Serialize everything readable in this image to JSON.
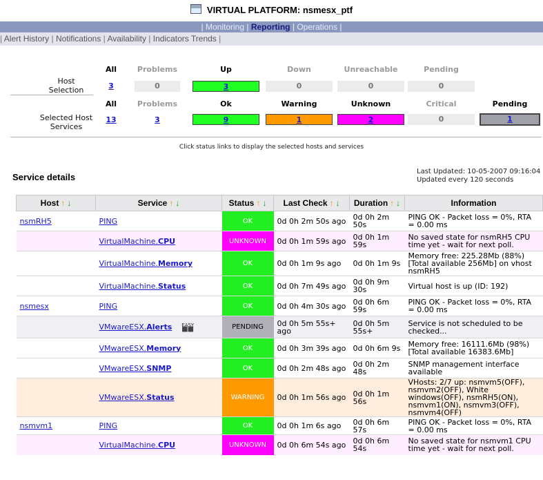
{
  "title": "VIRTUAL PLATFORM: nsmesx_ptf",
  "title_icon": "window-icon",
  "topnav": {
    "monitoring": "Monitoring",
    "reporting": "Reporting",
    "operations": "Operations",
    "sep": "|"
  },
  "subnav": {
    "lead_sep": "|",
    "alert_history": "Alert History",
    "notifications": "Notifications",
    "availability": "Availability",
    "indicators": "Indicators Trends",
    "sep": "|"
  },
  "summary": {
    "host_label": [
      "Host",
      "Selection"
    ],
    "services_label": [
      "Selected Host",
      "Services"
    ],
    "host_headers": {
      "all": "All",
      "problems": "Problems",
      "up": "Up",
      "down": "Down",
      "unreachable": "Unreachable",
      "pending": "Pending"
    },
    "host_values": {
      "all": "3",
      "problems": "0",
      "up": "3",
      "down": "0",
      "unreachable": "0",
      "pending": "0"
    },
    "svc_headers": {
      "all": "All",
      "problems": "Problems",
      "ok": "Ok",
      "warning": "Warning",
      "unknown": "Unknown",
      "critical": "Critical",
      "pending": "Pending"
    },
    "svc_values": {
      "all": "13",
      "problems": "3",
      "ok": "9",
      "warning": "1",
      "unknown": "2",
      "critical": "0",
      "pending": "1"
    },
    "hint": "Click status links to display the selected hosts and services"
  },
  "details": {
    "title": "Service details",
    "last_updated": "Last Updated: 10-05-2007 09:16:04",
    "refresh": "Updated every 120 seconds",
    "columns": {
      "host": "Host",
      "service": "Service",
      "status": "Status",
      "last_check": "Last Check",
      "duration": "Duration",
      "information": "Information"
    },
    "sort_up": "↑",
    "sort_down": "↓",
    "rows": [
      {
        "host": "nsmRH5",
        "svc_prefix": "PING",
        "svc_suffix": "",
        "status": "OK",
        "kind": "ok",
        "last_check": "0d 0h 2m 50s ago",
        "duration": "0d 0h 2m 50s",
        "info": "PING OK - Packet loss = 0%, RTA = 0.00 ms"
      },
      {
        "host": "",
        "svc_prefix": "VirtualMachine.",
        "svc_suffix": "CPU",
        "status": "UNKNOWN",
        "kind": "unk",
        "last_check": "0d 0h 1m 59s ago",
        "duration": "0d 0h 1m 59s",
        "info": "No saved state for nsmRH5 CPU time yet - wait for next poll."
      },
      {
        "host": "",
        "svc_prefix": "VirtualMachine.",
        "svc_suffix": "Memory",
        "status": "OK",
        "kind": "ok",
        "last_check": "0d 0h 1m 9s ago",
        "duration": "0d 0h 1m 9s",
        "info": "Memory free: 225.28Mb (88%) [Total available 256Mb] on vhost nsmRH5"
      },
      {
        "host": "",
        "svc_prefix": "VirtualMachine.",
        "svc_suffix": "Status",
        "status": "OK",
        "kind": "ok",
        "last_check": "0d 0h 7m 49s ago",
        "duration": "0d 0h 9m 30s",
        "info": "Virtual host is up (ID: 192)"
      },
      {
        "host": "nsmesx",
        "svc_prefix": "PING",
        "svc_suffix": "",
        "status": "OK",
        "kind": "ok",
        "last_check": "0d 0h 4m 30s ago",
        "duration": "0d 0h 6m 59s",
        "info": "PING OK - Packet loss = 0%, RTA = 0.00 ms"
      },
      {
        "host": "",
        "svc_prefix": "VMwareESX.",
        "svc_suffix": "Alerts",
        "status": "PENDING",
        "kind": "pending",
        "easy": [
          "EASY",
          "⬛⬛"
        ],
        "last_check": "0d 0h 5m 55s+ ago",
        "duration": "0d 0h 5m 55s+",
        "info": "Service is not scheduled to be checked..."
      },
      {
        "host": "",
        "svc_prefix": "VMwareESX.",
        "svc_suffix": "Memory",
        "status": "OK",
        "kind": "ok",
        "last_check": "0d 0h 3m 39s ago",
        "duration": "0d 0h 6m 9s",
        "info": "Memory free: 16111.6Mb (98%) [Total available 16383.6Mb]"
      },
      {
        "host": "",
        "svc_prefix": "VMwareESX.",
        "svc_suffix": "SNMP",
        "status": "OK",
        "kind": "ok",
        "last_check": "0d 0h 2m 48s ago",
        "duration": "0d 0h 2m 48s",
        "info": "SNMP management interface available"
      },
      {
        "host": "",
        "svc_prefix": "VMwareESX.",
        "svc_suffix": "Status",
        "status": "WARNING",
        "kind": "warn",
        "last_check": "0d 0h 1m 56s ago",
        "duration": "0d 0h 1m 56s",
        "info": "VHosts: 2/7 up: nsmvm5(OFF), nsmvm2(OFF), White windows(OFF), nsmRH5(ON), nsmvm1(ON), nsmvm3(OFF), nsmvm4(OFF)"
      },
      {
        "host": "nsmvm1",
        "svc_prefix": "PING",
        "svc_suffix": "",
        "status": "OK",
        "kind": "ok",
        "last_check": "0d 0h 1m 6s ago",
        "duration": "0d 0h 6m 57s",
        "info": "PING OK - Packet loss = 0%, RTA = 0.00 ms"
      },
      {
        "host": "",
        "svc_prefix": "VirtualMachine.",
        "svc_suffix": "CPU",
        "status": "UNKNOWN",
        "kind": "unk",
        "last_check": "0d 0h 6m 54s ago",
        "duration": "0d 0h 6m 54s",
        "info": "No saved state for nsmvm1 CPU time yet - wait for next poll."
      }
    ]
  },
  "colors": {
    "ok": "#22ee22",
    "unknown": "#ff00ff",
    "warning": "#ff9900",
    "pending": "#b0b0b8",
    "nav": "#8a98c0"
  }
}
